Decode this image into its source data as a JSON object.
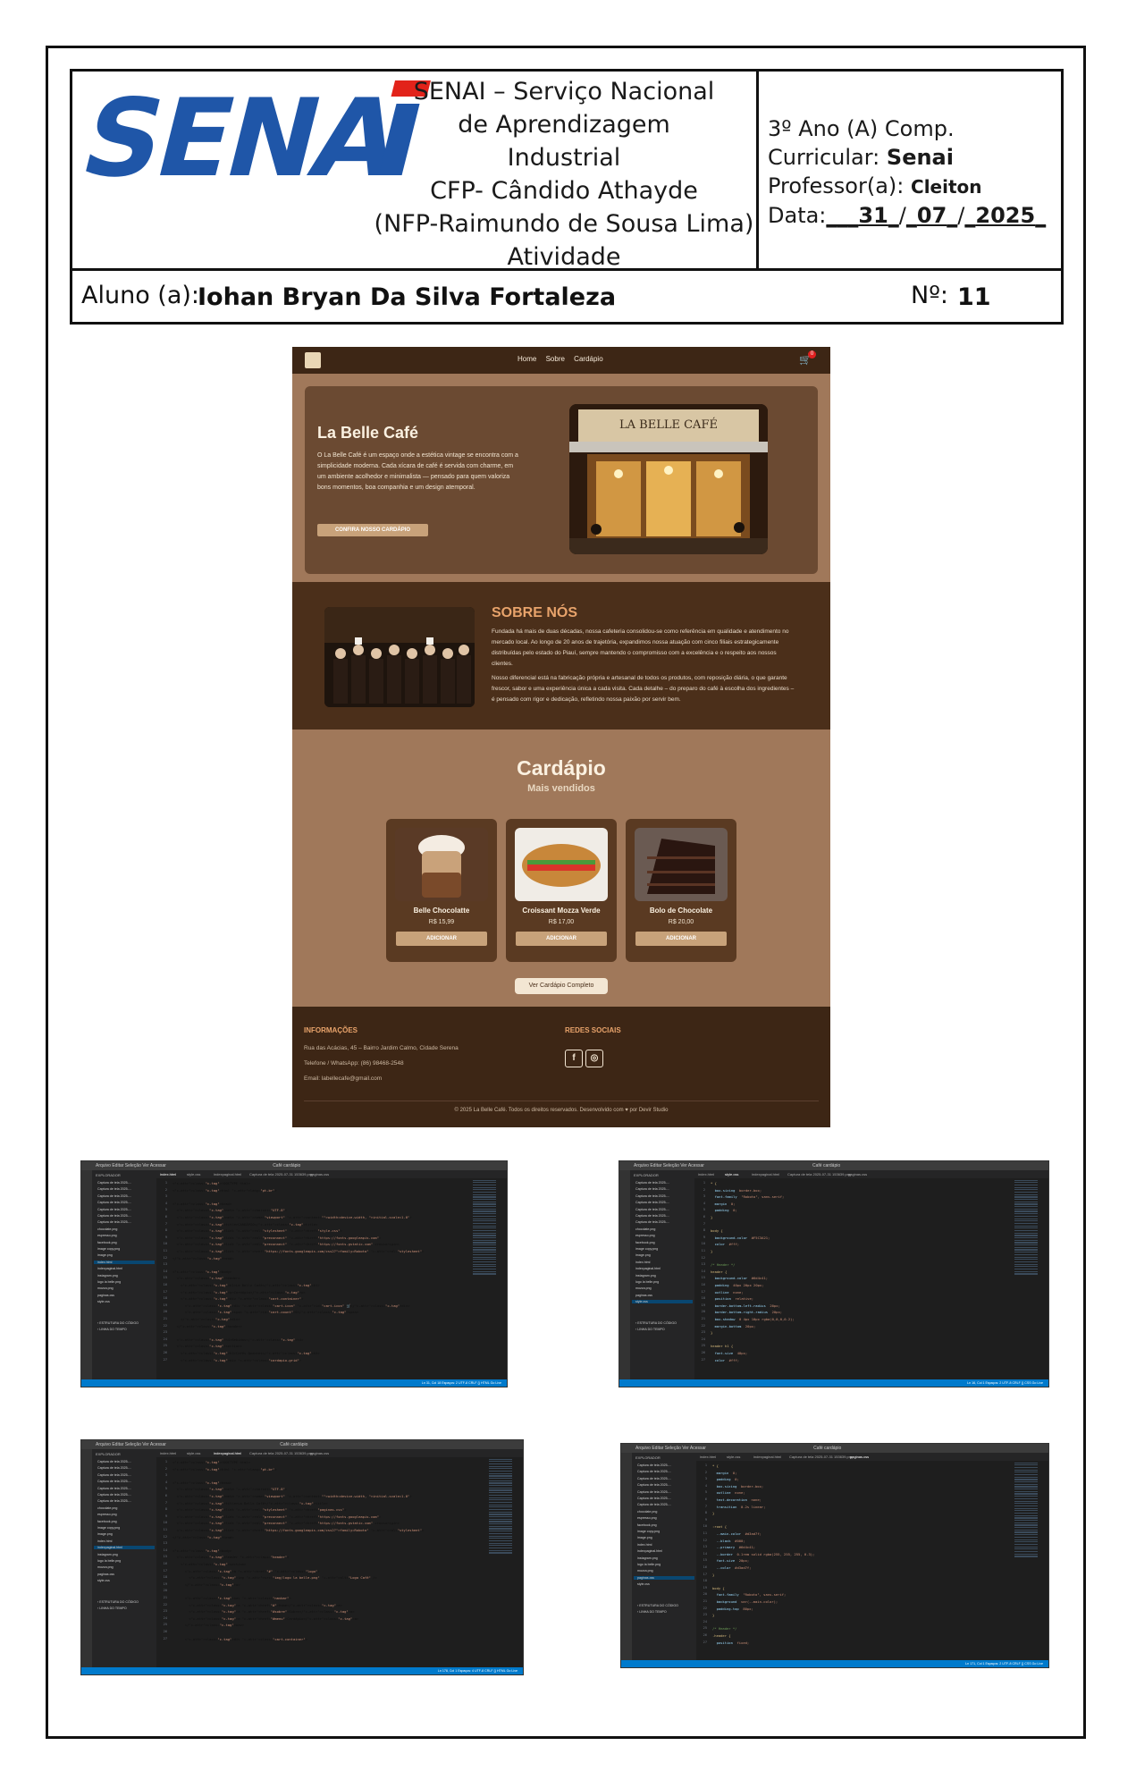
{
  "institution": {
    "logo_text": "SENAI",
    "lines": [
      "SENAI – Serviço Nacional",
      "de Aprendizagem",
      "Industrial",
      "CFP- Cândido Athayde",
      "(NFP-Raimundo de Sousa Lima)",
      "Atividade"
    ]
  },
  "meta": {
    "class_text": "3º Ano (A) Comp.",
    "curricular_label": "Curricular:",
    "curricular_value": "Senai",
    "professor_label": "Professor(a):",
    "professor_value": "Cleiton",
    "date_label": "Data:",
    "date_day": "31",
    "date_month": "07",
    "date_year": "2025"
  },
  "student": {
    "label": "Aluno (a):",
    "name": "Iohan Bryan Da Silva Fortaleza",
    "number_label": "Nº:",
    "number": "11"
  },
  "site": {
    "nav": [
      "Home",
      "Sobre",
      "Cardápio"
    ],
    "cart_count": "0",
    "hero": {
      "title": "La Belle Café",
      "text": "O La Belle Café é um espaço onde a estética vintage se encontra com a simplicidade moderna. Cada xícara de café é servida com charme, em um ambiente acolhedor e minimalista — pensado para quem valoriza bons momentos, boa companhia e um design atemporal.",
      "button": "CONFIRA NOSSO CARDÁPIO",
      "sign": "LA BELLE CAFÉ"
    },
    "about": {
      "title": "SOBRE NÓS",
      "p1": "Fundada há mais de duas décadas, nossa cafeteria consolidou-se como referência em qualidade e atendimento no mercado local. Ao longo de 20 anos de trajetória, expandimos nossa atuação com cinco filiais estrategicamente distribuídas pelo estado do Piauí, sempre mantendo o compromisso com a excelência e o respeito aos nossos clientes.",
      "p2": "Nosso diferencial está na fabricação própria e artesanal de todos os produtos, com reposição diária, o que garante frescor, sabor e uma experiência única a cada visita. Cada detalhe – do preparo do café à escolha dos ingredientes – é pensado com rigor e dedicação, refletindo nossa paixão por servir bem."
    },
    "menu": {
      "title": "Cardápio",
      "subtitle": "Mais vendidos",
      "items": [
        {
          "name": "Belle Chocolatte",
          "price": "R$ 15,99",
          "button": "ADICIONAR"
        },
        {
          "name": "Croissant Mozza Verde",
          "price": "R$ 17,00",
          "button": "ADICIONAR"
        },
        {
          "name": "Bolo de Chocolate",
          "price": "R$ 20,00",
          "button": "ADICIONAR"
        }
      ],
      "full_button": "Ver Cardápio Completo"
    },
    "footer": {
      "info_title": "INFORMAÇÕES",
      "address": "Rua das Acácias, 45 – Bairro Jardim Calmo, Cidade Serena",
      "phone": "Telefone / WhatsApp: (86) 98468-2548",
      "email": "Email: labellecafe@gmail.com",
      "social_title": "REDES SOCIAIS",
      "copyright": "© 2025 La Belle Café. Todos os direitos reservados. Desenvolvido com ♥ por Devir Studio"
    }
  },
  "editors": [
    {
      "title": "Café cardápio",
      "menu": "Arquivo  Editar  Seleção  Ver  Acessar",
      "tabs": [
        "index.html",
        "style.css",
        "indexpaginal.html",
        "Captura de tela 2025-07-31 153639.png",
        "paginas.css"
      ],
      "active_tab": 0,
      "status": "Ln 31, Col 18   Espaços: 2   UTF-8   CRLF   {} HTML   Go Live",
      "lines": [
        "<!DOCTYPE html>",
        "<html lang=\"pt-br\">",
        "",
        "<head>",
        "  <meta charset=\"UTF-8\">",
        "  <meta name=\"viewport\" content=\"width=device-width, initial-scale=1.0\">",
        "  <title>CARDÁPIO</title>",
        "  <link rel=\"stylesheet\" href=\"style.css\">",
        "  <link rel=\"preconnect\" href=\"https://fonts.googleapis.com\">",
        "  <link rel=\"preconnect\" href=\"https://fonts.gstatic.com\" crossorigin>",
        "  <link href=\"https://fonts.googleapis.com/css2?family=Roboto\" rel=\"stylesheet\">",
        "</head>",
        "",
        "<body>",
        "  <header>",
        "    <h1>La Belle Café</h1>",
        "    <p>Cardápio</p>",
        "    <div class=\"cart-container\">",
        "      <div class=\"cart-icon\" id=\"cart-icon\">🛒</div>",
        "      <span id=\"cart-count\">0</span>",
        "    </div>",
        "  </header>",
        "",
        "  <h4>Bebidas</h4>",
        "  <section>",
        "    <h2>Cafés Quentes</h2>",
        "    <div class=\"cardapio-grid\">"
      ]
    },
    {
      "title": "Café cardápio",
      "menu": "Arquivo  Editar  Seleção  Ver  Acessar",
      "tabs": [
        "index.html",
        "style.css",
        "indexpaginal.html",
        "Captura de tela 2025-07-31 153639.png",
        "paginas.css"
      ],
      "active_tab": 1,
      "status": "Ln 16, Col 1   Espaços: 2   UTF-8   CRLF   {} CSS   Go Live",
      "lines": [
        "* {",
        "  box-sizing: border-box;",
        "  font-family: \"Roboto\", sans-serif;",
        "  margin: 0;",
        "  padding: 0;",
        "}",
        "",
        "body {",
        "  background-color: #F5C3A21;",
        "  color: #fff;",
        "}",
        "",
        "/* Header */",
        "header {",
        "  background-color: #6d4c41;",
        "  padding: 40px 20px 20px;",
        "  outline: none;",
        "  position: relative;",
        "  border-bottom-left-radius: 20px;",
        "  border-bottom-right-radius: 20px;",
        "  box-shadow: 0 4px 10px rgba(0,0,0,0.2);",
        "  margin-bottom: 20px;",
        "}",
        "",
        "header h1 {",
        "  font-size: 48px;",
        "  color: #fff;"
      ]
    },
    {
      "title": "Café cardápio",
      "menu": "Arquivo  Editar  Seleção  Ver  Acessar",
      "tabs": [
        "index.html",
        "style.css",
        "indexpaginal.html",
        "Captura de tela 2025-07-31 153639.png",
        "paginas.css"
      ],
      "active_tab": 2,
      "status": "Ln 178, Col 1   Espaços: 4   UTF-8   CRLF   {} HTML   Go Live",
      "lines": [
        "<!DOCTYPE html>",
        "<html lang=\"pt-br\">",
        "",
        "<head>",
        "  <meta charset=\"UTF-8\">",
        "  <meta name=\"viewport\" content=\"width=device-width, initial-scale=1.0\">",
        "  <title>La Belle Café</title>",
        "  <link rel=\"stylesheet\" href=\"paginas.css\">",
        "  <link rel=\"preconnect\" href=\"https://fonts.googleapis.com\">",
        "  <link rel=\"preconnect\" href=\"https://fonts.gstatic.com\" crossorigin>",
        "  <link href=\"https://fonts.googleapis.com/css2?family=Roboto\" rel=\"stylesheet\">",
        "</head>",
        "",
        "<body>",
        "  <header class=\"header\">",
        "    <section>",
        "      <a href=\"#\" class=\"logo\">",
        "        <img src=\"img/logo la belle.png\" alt=\"Logo Café\" />",
        "      </a>",
        "",
        "      <nav class=\"navbar\">",
        "        <a href=\"#\">Home</a>",
        "        <a href=\"#sobre\">Sobre</a>",
        "        <a href=\"#menu\">Cardápio</a>",
        "      </nav>",
        "",
        "      <div class=\"cart-container\">"
      ]
    },
    {
      "title": "Café cardápio",
      "menu": "Arquivo  Editar  Seleção  Ver  Acessar",
      "tabs": [
        "index.html",
        "style.css",
        "indexpaginal.html",
        "Captura de tela 2025-07-31 153639.png",
        "paginas.css"
      ],
      "active_tab": 4,
      "status": "Ln 171, Col 1   Espaços: 2   UTF-8   CRLF   {} CSS   Go Live",
      "lines": [
        "* {",
        "  margin: 0;",
        "  padding: 0;",
        "  box-sizing: border-box;",
        "  outline: none;",
        "  text-decoration: none;",
        "  transition: 0.2s linear;",
        "}",
        "",
        ":root {",
        "  --main-color: #d3ad7f;",
        "  --black: #000;",
        "  --primary: #6d4c41;",
        "  --border: 0.1rem solid rgba(255, 255, 255, 0.3);",
        "  font-size: 20px;",
        "  --color: #d3ad7f;",
        "}",
        "",
        "body {",
        "  font-family: \"Roboto\", sans-serif;",
        "  background: var(--main-color);",
        "  padding-top: 80px;",
        "}",
        "",
        "/* Header */",
        ".header {",
        "  position: fixed;"
      ]
    }
  ],
  "explorer": {
    "header": "EXPLORADOR",
    "files": [
      "Captura de tela 2025-...",
      "Captura de tela 2025-...",
      "Captura de tela 2025-...",
      "Captura de tela 2025-...",
      "Captura de tela 2025-...",
      "Captura de tela 2025-...",
      "Captura de tela 2025-...",
      "chocolate.png",
      "espresso.png",
      "facebook.png",
      "image copy.png",
      "image.png",
      "index.html",
      "indexpaginal.html",
      "instagram.png",
      "logo la belle.png",
      "mozza.png",
      "paginas.css",
      "style.css"
    ],
    "bottom": [
      "ESTRUTURA DO CÓDIGO",
      "LINHA DO TEMPO"
    ]
  }
}
